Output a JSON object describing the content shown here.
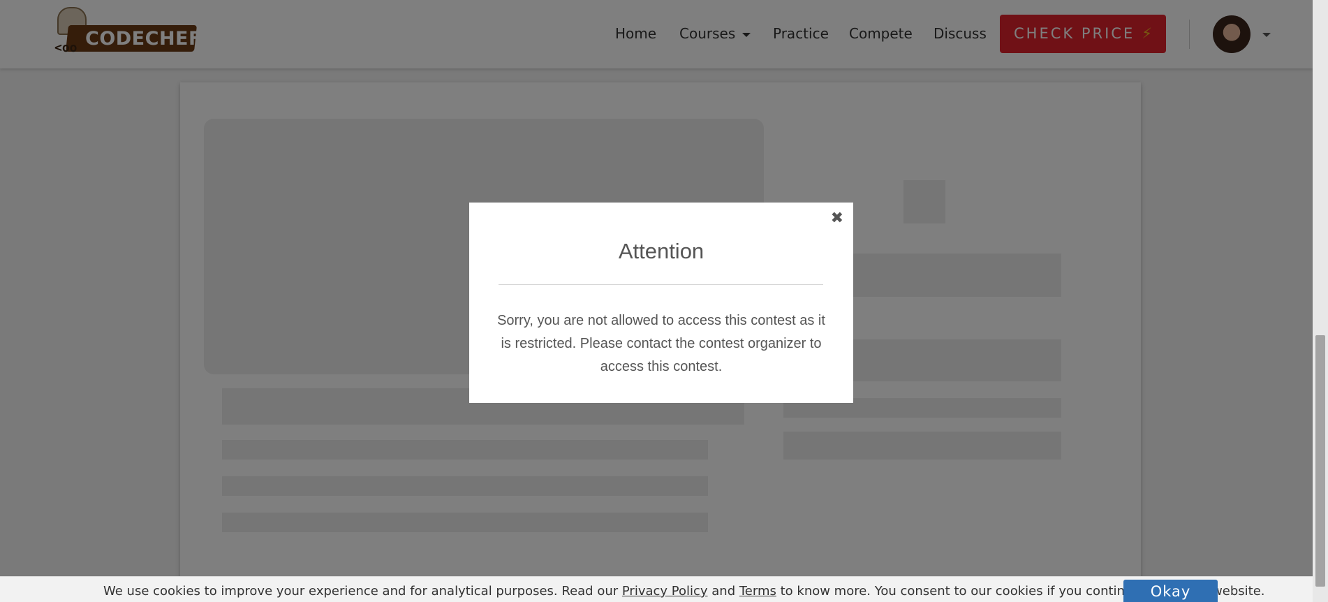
{
  "header": {
    "logo_text": "CODECHEF",
    "logo_glyph": "<oo",
    "nav": {
      "home": "Home",
      "courses": "Courses",
      "practice": "Practice",
      "compete": "Compete",
      "discuss": "Discuss"
    },
    "cta_label": "CHECK PRICE",
    "cta_icon": "⚡",
    "colors": {
      "cta": "#e1222c",
      "logo_banner": "#6b3b14"
    }
  },
  "modal": {
    "title": "Attention",
    "close_icon": "✖",
    "message": "Sorry, you are not allowed to access this contest as it is restricted. Please contact the contest organizer to access this contest."
  },
  "cookie_bar": {
    "text_before": "We use cookies to improve your experience and for analytical purposes. Read our ",
    "privacy_link": "Privacy Policy",
    "text_and": " and ",
    "terms_link": "Terms",
    "text_after": " to know more. You consent to our cookies if you continue to use our website.",
    "okay_label": "Okay",
    "colors": {
      "okay_button": "#2f6fb3"
    }
  }
}
